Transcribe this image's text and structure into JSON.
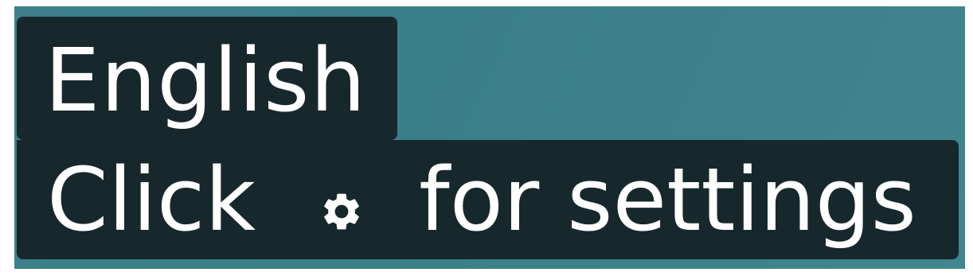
{
  "caption": {
    "language_label": "English",
    "hint_prefix": "Click",
    "hint_icon": "gear-icon",
    "hint_suffix": "for settings"
  },
  "colors": {
    "background": "#3d8089",
    "caption_bg": "#17282c",
    "caption_text": "#ffffff"
  }
}
